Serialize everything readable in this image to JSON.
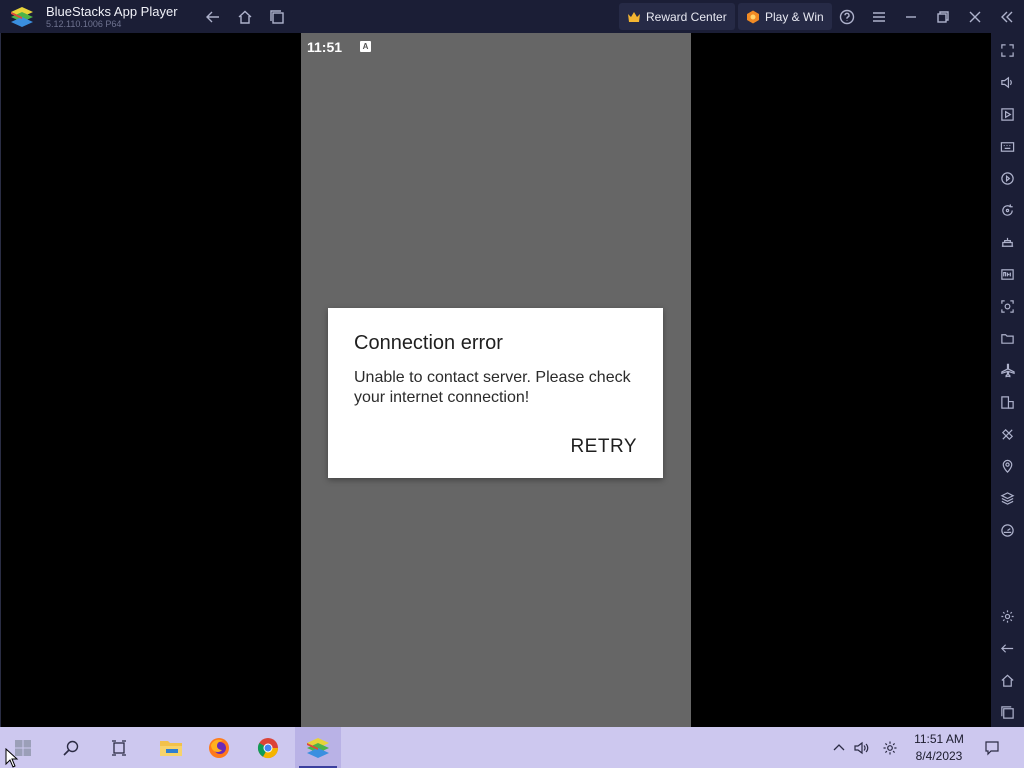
{
  "window": {
    "title": "BlueStacks App Player",
    "version": "5.12.110.1006  P64",
    "reward_center": "Reward Center",
    "play_win": "Play & Win"
  },
  "android": {
    "status_time": "11:51",
    "status_badge": "A"
  },
  "dialog": {
    "title": "Connection error",
    "message": "Unable to contact server. Please check your internet connection!",
    "button": "RETRY"
  },
  "sidebar": {
    "icons": [
      "fullscreen-icon",
      "volume-icon",
      "media-icon",
      "keyboard-icon",
      "macro-play-icon",
      "rotate-icon",
      "game-controls-icon",
      "apk-install-icon",
      "screenshot-icon",
      "folder-icon",
      "airplane-icon",
      "multi-instance-icon",
      "eco-mode-icon",
      "location-icon",
      "layers-icon",
      "performance-icon",
      "settings-icon",
      "back-icon",
      "home-icon",
      "recent-apps-icon"
    ]
  },
  "taskbar": {
    "time": "11:51 AM",
    "date": "8/4/2023"
  },
  "colors": {
    "titlebar": "#1b1e36",
    "android_bg": "#666666",
    "dialog_bg": "#ffffff",
    "taskbar": "#cdc8ef"
  }
}
